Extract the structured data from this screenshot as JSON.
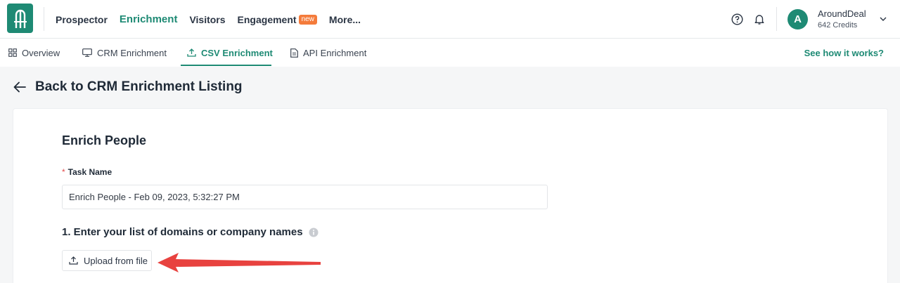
{
  "header": {
    "nav": [
      {
        "label": "Prospector"
      },
      {
        "label": "Enrichment"
      },
      {
        "label": "Visitors"
      },
      {
        "label": "Engagement",
        "badge": "new"
      },
      {
        "label": "More..."
      }
    ],
    "account": {
      "avatar_letter": "A",
      "name": "AroundDeal",
      "credits": "642 Credits"
    }
  },
  "tabs": [
    {
      "label": "Overview",
      "icon": "grid-icon"
    },
    {
      "label": "CRM Enrichment",
      "icon": "monitor-icon"
    },
    {
      "label": "CSV Enrichment",
      "icon": "upload-icon"
    },
    {
      "label": "API Enrichment",
      "icon": "document-icon"
    }
  ],
  "help_link": "See how it works?",
  "back_title": "Back to CRM Enrichment Listing",
  "form": {
    "section_title": "Enrich People",
    "required_mark": "*",
    "task_name_label": "Task Name",
    "task_name_value": "Enrich People - Feb 09, 2023, 5:32:27 PM",
    "step_title": "1. Enter your list of domains or company names",
    "upload_label": "Upload from file"
  },
  "colors": {
    "brand": "#1e8a74",
    "badge": "#f47b3b",
    "annotation_arrow": "#e8423f"
  }
}
